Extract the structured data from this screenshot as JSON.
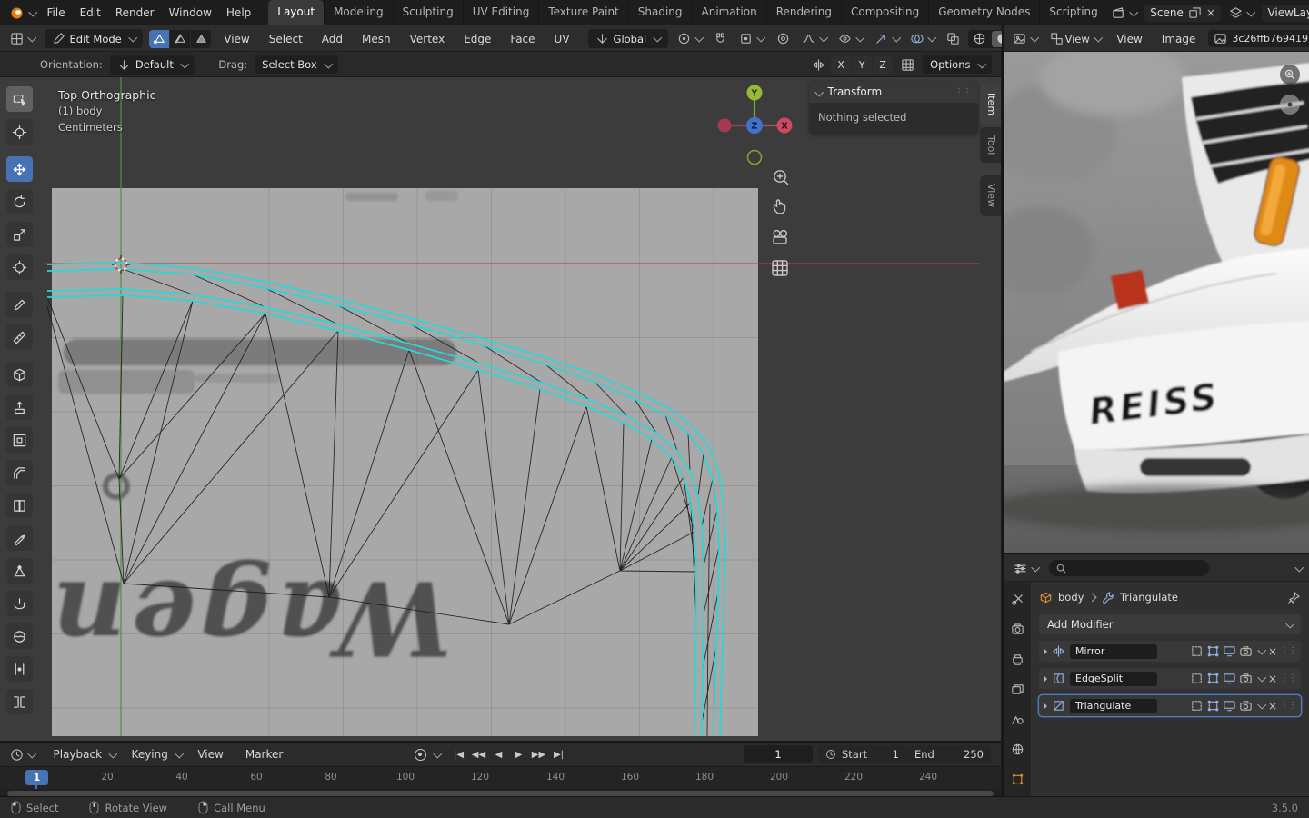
{
  "topbar": {
    "menus": [
      "File",
      "Edit",
      "Render",
      "Window",
      "Help"
    ],
    "workspaces": [
      "Layout",
      "Modeling",
      "Sculpting",
      "UV Editing",
      "Texture Paint",
      "Shading",
      "Animation",
      "Rendering",
      "Compositing",
      "Geometry Nodes",
      "Scripting"
    ],
    "scene_label": "Scene",
    "view_layer_label": "View Layer",
    "view_layer_value": "ViewLayer"
  },
  "viewport_header": {
    "mode_label": "Edit Mode",
    "menus": [
      "View",
      "Select",
      "Add",
      "Mesh",
      "Vertex",
      "Edge",
      "Face",
      "UV"
    ],
    "orientation_value": "Global"
  },
  "tool_settings": {
    "orientation_label": "Orientation:",
    "orientation_value": "Default",
    "drag_label": "Drag:",
    "drag_value": "Select Box",
    "axis_x": "X",
    "axis_y": "Y",
    "axis_z": "Z",
    "options_label": "Options"
  },
  "viewport": {
    "overlay": {
      "line1": "Top Orthographic",
      "line2": "(1) body",
      "line3": "Centimeters"
    },
    "transform_panel": {
      "title": "Transform",
      "message": "Nothing selected"
    },
    "side_tabs": [
      "Item",
      "Tool",
      "View"
    ],
    "gizmo": {
      "x": "X",
      "y": "Y",
      "z": "Z"
    },
    "reference_text": "Wagen"
  },
  "image_editor": {
    "view_mode_label": "View",
    "menus": [
      "View",
      "Image"
    ],
    "image_name": "3c26ffb769419",
    "photo_text": "REISS"
  },
  "properties": {
    "breadcrumb": {
      "object": "body",
      "modifier": "Triangulate"
    },
    "add_modifier_label": "Add Modifier",
    "modifiers": [
      {
        "name": "Mirror"
      },
      {
        "name": "EdgeSplit"
      },
      {
        "name": "Triangulate"
      }
    ]
  },
  "timeline": {
    "menus": [
      "Playback",
      "Keying",
      "View",
      "Marker"
    ],
    "current_frame": "1",
    "playhead_frame": "1",
    "start_label": "Start",
    "start_value": "1",
    "end_label": "End",
    "end_value": "250",
    "ticks": [
      "20",
      "40",
      "60",
      "80",
      "100",
      "120",
      "140",
      "160",
      "180",
      "200",
      "220",
      "240"
    ]
  },
  "status_bar": {
    "select_label": "Select",
    "rotate_label": "Rotate View",
    "menu_label": "Call Menu",
    "version": "3.5.0"
  },
  "colors": {
    "accent": "#4772b3",
    "selection_cyan": "#25d9d9",
    "axis_x": "#c4465e",
    "axis_y": "#83a32e",
    "axis_z": "#3f74c9"
  }
}
